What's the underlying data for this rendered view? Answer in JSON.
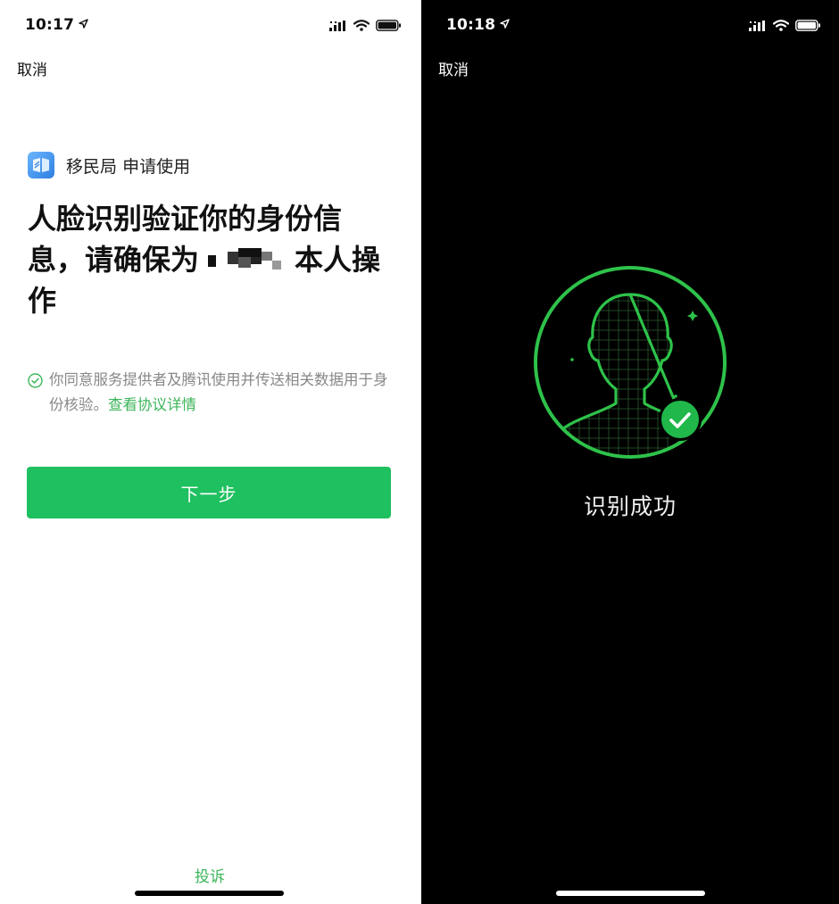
{
  "left": {
    "status": {
      "time": "10:17"
    },
    "cancel_label": "取消",
    "app": {
      "name": "移民局",
      "action": "申请使用"
    },
    "headline": {
      "line_before": "人脸识别验证你的身份信息，请确保为",
      "line_after": "本人操作"
    },
    "consent": {
      "text": "你同意服务提供者及腾讯使用并传送相关数据用于身份核验。",
      "link": "查看协议详情"
    },
    "next_button": "下一步",
    "complaint_link": "投诉"
  },
  "right": {
    "status": {
      "time": "10:18"
    },
    "cancel_label": "取消",
    "success_text": "识别成功"
  },
  "colors": {
    "accent_green": "#1fc05f",
    "link_green": "#3cb55a",
    "scan_green": "#2ec24a",
    "right_background": "#000000"
  },
  "icons": [
    "location-arrow-icon",
    "signal-icon",
    "wifi-icon",
    "battery-icon",
    "checkmark-circle-icon",
    "face-scan-icon",
    "success-check-icon"
  ]
}
